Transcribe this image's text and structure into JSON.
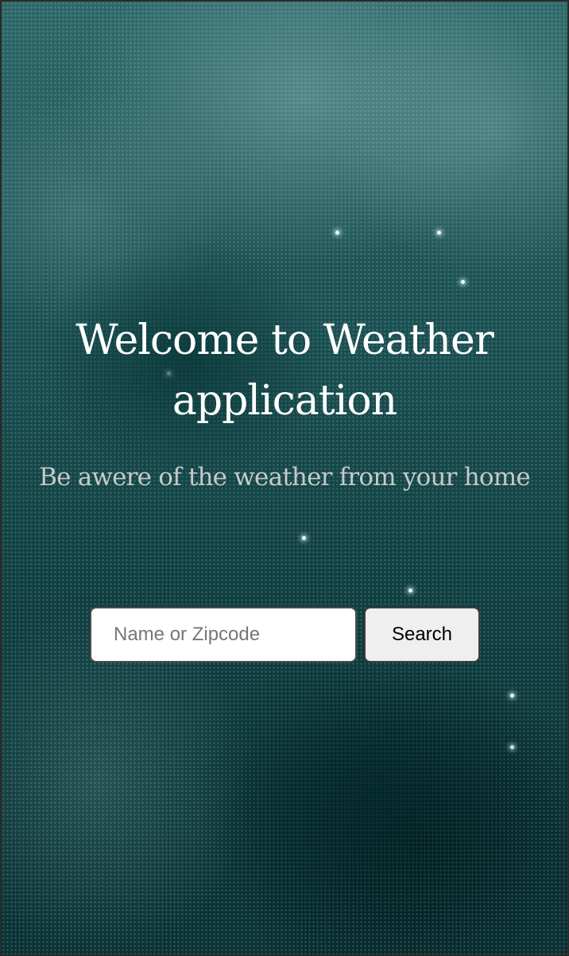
{
  "hero": {
    "title": "Welcome to Weather application",
    "subtitle": "Be awere of the weather from your home"
  },
  "search": {
    "placeholder": "Name or Zipcode",
    "value": "",
    "button_label": "Search"
  },
  "colors": {
    "background_teal": "#0c3a3b",
    "title_text": "#ffffff",
    "subtitle_text": "#c7c9c9",
    "button_bg": "#efefef"
  }
}
